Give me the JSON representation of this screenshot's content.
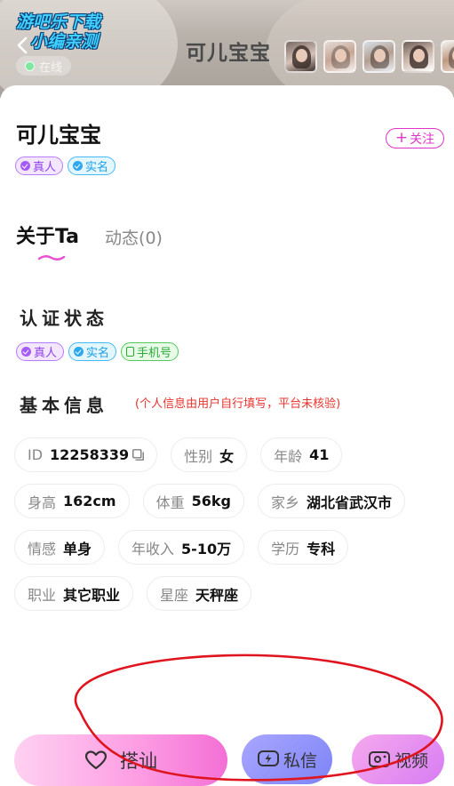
{
  "watermark": {
    "line1": "游吧乐下载",
    "line2": "小编亲测"
  },
  "header": {
    "title": "可儿宝宝",
    "status": "在线",
    "photo_count": 5
  },
  "profile": {
    "name": "可儿宝宝",
    "follow_label": "关注",
    "badges": [
      "真人",
      "实名"
    ]
  },
  "tabs": [
    {
      "label": "关于Ta",
      "active": true
    },
    {
      "label": "动态(0)",
      "active": false
    }
  ],
  "verification": {
    "title": "认证状态",
    "badges": [
      "真人",
      "实名",
      "手机号"
    ]
  },
  "basic_info": {
    "title": "基本信息",
    "note": "(个人信息由用户自行填写，平台未核验)",
    "rows": [
      [
        {
          "key": "ID",
          "value": "12258339"
        },
        {
          "key": "性别",
          "value": "女"
        },
        {
          "key": "年龄",
          "value": "41"
        }
      ],
      [
        {
          "key": "身高",
          "value": "162cm"
        },
        {
          "key": "体重",
          "value": "56kg"
        },
        {
          "key": "家乡",
          "value": "湖北省武汉市"
        }
      ],
      [
        {
          "key": "情感",
          "value": "单身"
        },
        {
          "key": "年收入",
          "value": "5-10万"
        },
        {
          "key": "学历",
          "value": "专科"
        }
      ],
      [
        {
          "key": "职业",
          "value": "其它职业"
        },
        {
          "key": "星座",
          "value": "天秤座"
        }
      ]
    ]
  },
  "actions": {
    "chat_label": "搭讪",
    "message_label": "私信",
    "video_label": "视频"
  },
  "colors": {
    "accent_pink": "#e233c8",
    "note_red": "#e8332e",
    "annotation_red": "#e0141e"
  }
}
